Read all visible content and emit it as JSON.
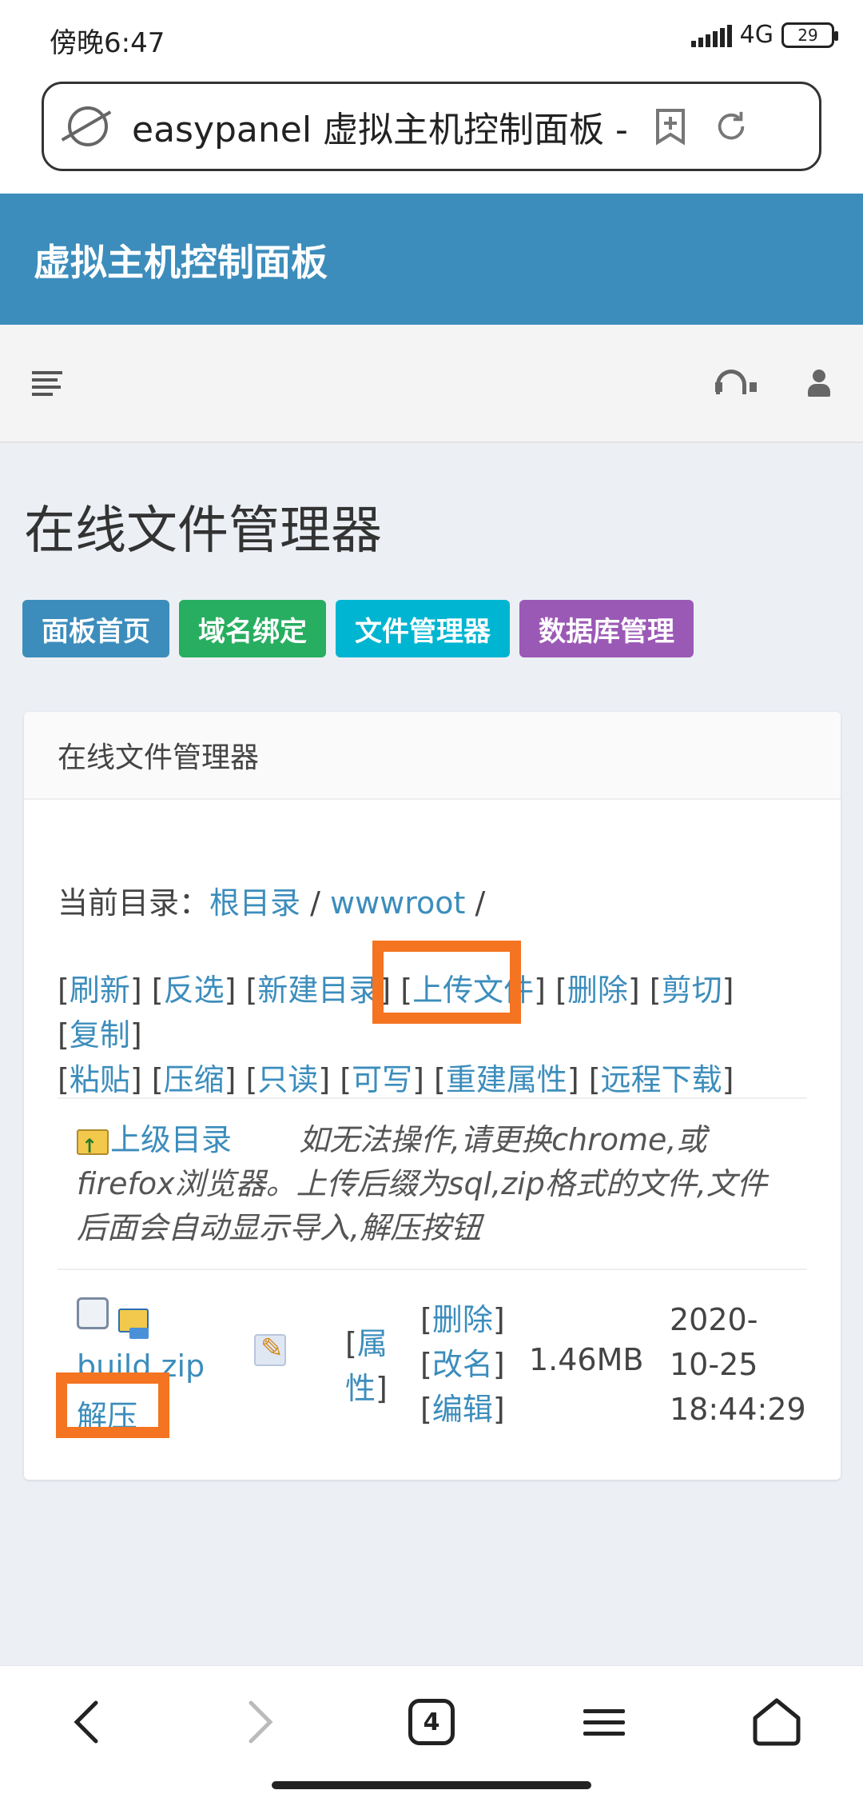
{
  "status": {
    "time": "傍晚6:47",
    "network": "4G",
    "battery": "29"
  },
  "browser": {
    "url": "easypanel 虚拟主机控制面板 -",
    "tab_count": "4"
  },
  "header": {
    "brand": "虚拟主机控制面板"
  },
  "page": {
    "title": "在线文件管理器"
  },
  "nav_buttons": [
    {
      "label": "面板首页",
      "color": "#3c8dbc"
    },
    {
      "label": "域名绑定",
      "color": "#27ae60"
    },
    {
      "label": "文件管理器",
      "color": "#00b5d1"
    },
    {
      "label": "数据库管理",
      "color": "#9b59b6"
    }
  ],
  "box": {
    "title": "在线文件管理器",
    "current_dir_label": "当前目录：",
    "breadcrumb": {
      "root": "根目录",
      "sep1": " / ",
      "folder": "wwwroot",
      "sep2": " /"
    },
    "actions": [
      "刷新",
      "反选",
      "新建目录",
      "上传文件",
      "删除",
      "剪切",
      "复制",
      "粘贴",
      "压缩",
      "只读",
      "可写",
      "重建属性",
      "远程下载"
    ],
    "parent_link": "上级目录",
    "note": "如无法操作,请更换chrome,或firefox浏览器。上传后缀为sql,zip格式的文件,文件后面会自动显示导入,解压按钮",
    "file": {
      "name": "build.zip",
      "unzip": "解压",
      "prop": "属性",
      "ops": [
        "删除",
        "改名",
        "编辑"
      ],
      "size": "1.46MB",
      "date_lines": [
        "2020-",
        "10-25",
        "18:44:29"
      ]
    }
  },
  "highlight_color": "#f47421"
}
